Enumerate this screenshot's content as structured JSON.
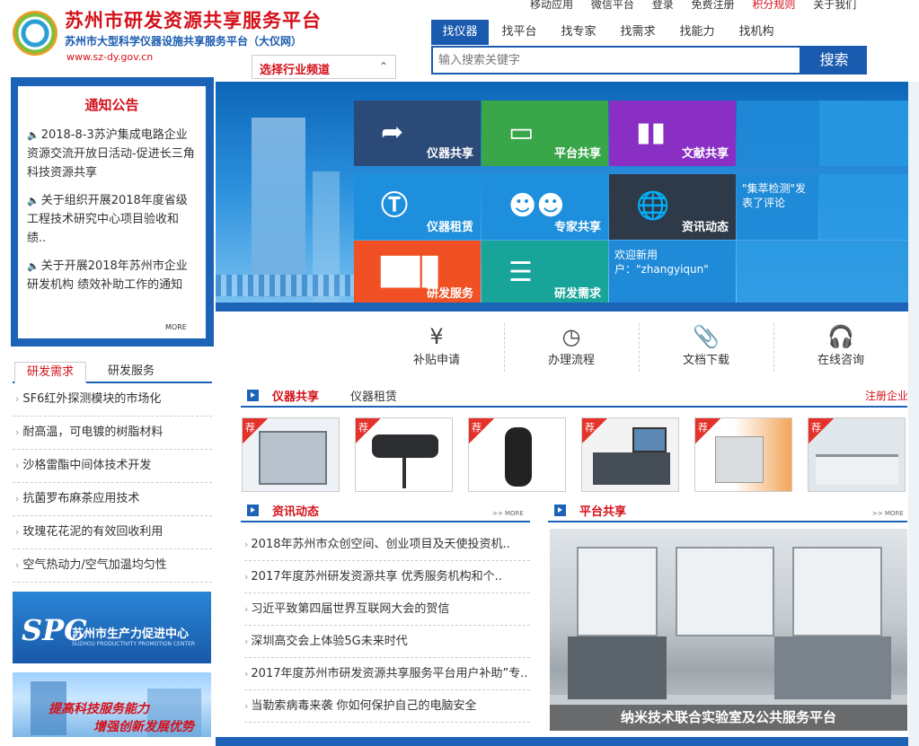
{
  "header": {
    "title": "苏州市研发资源共享服务平台",
    "subtitle": "苏州市大型科学仪器设施共享服务平台（大仪网）",
    "url": "www.sz-dy.gov.cn",
    "channel_select": "选择行业频道",
    "top_links": [
      "移动应用",
      "微信平台",
      "登录",
      "免费注册",
      "积分规则",
      "关于我们"
    ]
  },
  "search": {
    "tabs": [
      "找仪器",
      "找平台",
      "找专家",
      "找需求",
      "找能力",
      "找机构"
    ],
    "active_tab": "找仪器",
    "placeholder": "输入搜索关键字",
    "button": "搜索"
  },
  "notice": {
    "title": "通知公告",
    "items": [
      "2018-8-3苏沪集成电路企业资源交流开放日活动-促进长三角科技资源共享",
      "关于组织开展2018年度省级工程技术研究中心项目验收和绩..",
      "关于开展2018年苏州市企业研发机构 绩效补助工作的通知"
    ],
    "more": "MORE"
  },
  "left_tabs": {
    "tab1": "研发需求",
    "tab2": "研发服务"
  },
  "needs": [
    "SF6红外探测模块的市场化",
    "耐高温，可电镀的树脂材料",
    "沙格雷酯中间体技术开发",
    "抗菌罗布麻茶应用技术",
    "玫瑰花花泥的有效回收利用",
    "空气热动力/空气加温均匀性"
  ],
  "banners": {
    "spc_logo": "SPC",
    "spc_text": "苏州市生产力促进中心",
    "spc_sub": "SUZHOU PRODUCTIVITY PROMOTION CENTER",
    "sci_line1": "提高科技服务能力",
    "sci_line2": "增强创新发展优势"
  },
  "tiles": {
    "instrument_share": "仪器共享",
    "platform_share": "平台共享",
    "literature_share": "文献共享",
    "instrument_rent": "仪器租赁",
    "expert_share": "专家共享",
    "news": "资讯动态",
    "rd_service": "研发服务",
    "rd_need": "研发需求",
    "comment_text": "\"集萃检测\"发表了评论",
    "welcome_text": "欢迎新用户：\"zhangyiqun\""
  },
  "quick_links": [
    "补贴申请",
    "办理流程",
    "文档下载",
    "在线咨询"
  ],
  "instruments": {
    "tab_active": "仪器共享",
    "tab_other": "仪器租赁",
    "register": "注册企业",
    "badge": "荐"
  },
  "news": {
    "title": "资讯动态",
    "more": ">> MORE",
    "items": [
      "2018年苏州市众创空间、创业项目及天使投资机..",
      "2017年度苏州研发资源共享 优秀服务机构和个..",
      "习近平致第四届世界互联网大会的贺信",
      "深圳高交会上体验5G未来时代",
      "2017年度苏州市研发资源共享服务平台用户补助”专..",
      "当勒索病毒来袭 你如何保护自己的电脑安全"
    ]
  },
  "platform": {
    "title": "平台共享",
    "more": ">> MORE",
    "caption": "纳米技术联合实验室及公共服务平台"
  }
}
